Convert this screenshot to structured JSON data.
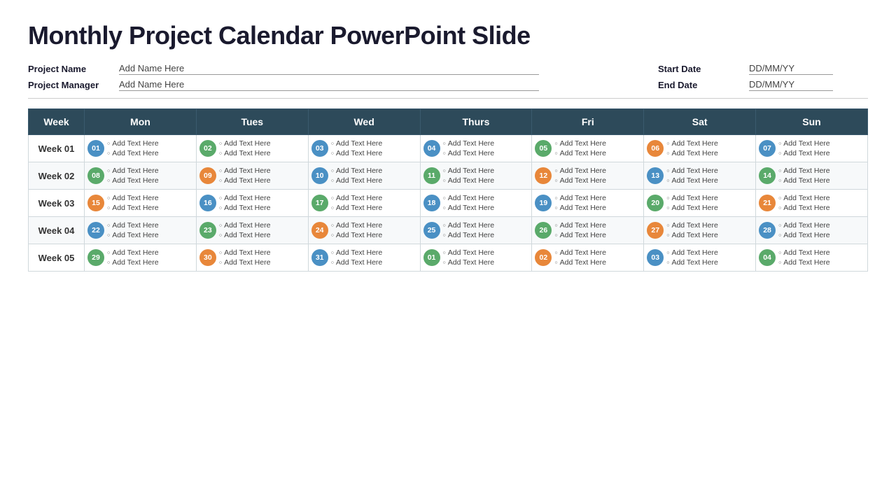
{
  "title": "Monthly Project Calendar PowerPoint Slide",
  "meta": {
    "project_name_label": "Project Name",
    "project_name_value": "Add Name Here",
    "project_manager_label": "Project Manager",
    "project_manager_value": "Add Name Here",
    "start_date_label": "Start Date",
    "start_date_value": "DD/MM/YY",
    "end_date_label": "End Date",
    "end_date_value": "DD/MM/YY"
  },
  "table": {
    "headers": [
      "Week",
      "Mon",
      "Tues",
      "Wed",
      "Thurs",
      "Fri",
      "Sat",
      "Sun"
    ],
    "rows": [
      {
        "week": "Week 01",
        "days": [
          {
            "num": "01",
            "color": "badge-blue",
            "text1": "Add Text Here",
            "text2": "Add Text Here"
          },
          {
            "num": "02",
            "color": "badge-green",
            "text1": "Add Text Here",
            "text2": "Add Text Here"
          },
          {
            "num": "03",
            "color": "badge-blue",
            "text1": "Add Text Here",
            "text2": "Add Text Here"
          },
          {
            "num": "04",
            "color": "badge-blue",
            "text1": "Add Text Here",
            "text2": "Add Text Here"
          },
          {
            "num": "05",
            "color": "badge-green",
            "text1": "Add Text Here",
            "text2": "Add Text Here"
          },
          {
            "num": "06",
            "color": "badge-orange",
            "text1": "Add Text Here",
            "text2": "Add Text Here"
          },
          {
            "num": "07",
            "color": "badge-blue",
            "text1": "Add Text Here",
            "text2": "Add Text Here"
          }
        ]
      },
      {
        "week": "Week 02",
        "days": [
          {
            "num": "08",
            "color": "badge-green",
            "text1": "Add Text Here",
            "text2": "Add Text Here"
          },
          {
            "num": "09",
            "color": "badge-orange",
            "text1": "Add Text Here",
            "text2": "Add Text Here"
          },
          {
            "num": "10",
            "color": "badge-blue",
            "text1": "Add Text Here",
            "text2": "Add Text Here"
          },
          {
            "num": "11",
            "color": "badge-green",
            "text1": "Add Text Here",
            "text2": "Add Text Here"
          },
          {
            "num": "12",
            "color": "badge-orange",
            "text1": "Add Text Here",
            "text2": "Add Text Here"
          },
          {
            "num": "13",
            "color": "badge-blue",
            "text1": "Add Text Here",
            "text2": "Add Text Here"
          },
          {
            "num": "14",
            "color": "badge-green",
            "text1": "Add Text Here",
            "text2": "Add Text Here"
          }
        ]
      },
      {
        "week": "Week 03",
        "days": [
          {
            "num": "15",
            "color": "badge-orange",
            "text1": "Add Text Here",
            "text2": "Add Text Here"
          },
          {
            "num": "16",
            "color": "badge-blue",
            "text1": "Add Text Here",
            "text2": "Add Text Here"
          },
          {
            "num": "17",
            "color": "badge-green",
            "text1": "Add Text Here",
            "text2": "Add Text Here"
          },
          {
            "num": "18",
            "color": "badge-blue",
            "text1": "Add Text Here",
            "text2": "Add Text Here"
          },
          {
            "num": "19",
            "color": "badge-blue",
            "text1": "Add Text Here",
            "text2": "Add Text Here"
          },
          {
            "num": "20",
            "color": "badge-green",
            "text1": "Add Text Here",
            "text2": "Add Text Here"
          },
          {
            "num": "21",
            "color": "badge-orange",
            "text1": "Add Text Here",
            "text2": "Add Text Here"
          }
        ]
      },
      {
        "week": "Week 04",
        "days": [
          {
            "num": "22",
            "color": "badge-blue",
            "text1": "Add Text Here",
            "text2": "Add Text Here"
          },
          {
            "num": "23",
            "color": "badge-green",
            "text1": "Add Text Here",
            "text2": "Add Text Here"
          },
          {
            "num": "24",
            "color": "badge-orange",
            "text1": "Add Text Here",
            "text2": "Add Text Here"
          },
          {
            "num": "25",
            "color": "badge-blue",
            "text1": "Add Text Here",
            "text2": "Add Text Here"
          },
          {
            "num": "26",
            "color": "badge-green",
            "text1": "Add Text Here",
            "text2": "Add Text Here"
          },
          {
            "num": "27",
            "color": "badge-orange",
            "text1": "Add Text Here",
            "text2": "Add Text Here"
          },
          {
            "num": "28",
            "color": "badge-blue",
            "text1": "Add Text Here",
            "text2": "Add Text Here"
          }
        ]
      },
      {
        "week": "Week 05",
        "days": [
          {
            "num": "29",
            "color": "badge-green",
            "text1": "Add Text Here",
            "text2": "Add Text Here"
          },
          {
            "num": "30",
            "color": "badge-orange",
            "text1": "Add Text Here",
            "text2": "Add Text Here"
          },
          {
            "num": "31",
            "color": "badge-blue",
            "text1": "Add Text Here",
            "text2": "Add Text Here"
          },
          {
            "num": "01",
            "color": "badge-green",
            "text1": "Add Text Here",
            "text2": "Add Text Here"
          },
          {
            "num": "02",
            "color": "badge-orange",
            "text1": "Add Text Here",
            "text2": "Add Text Here"
          },
          {
            "num": "03",
            "color": "badge-blue",
            "text1": "Add Text Here",
            "text2": "Add Text Here"
          },
          {
            "num": "04",
            "color": "badge-green",
            "text1": "Add Text Here",
            "text2": "Add Text Here"
          }
        ]
      }
    ]
  }
}
